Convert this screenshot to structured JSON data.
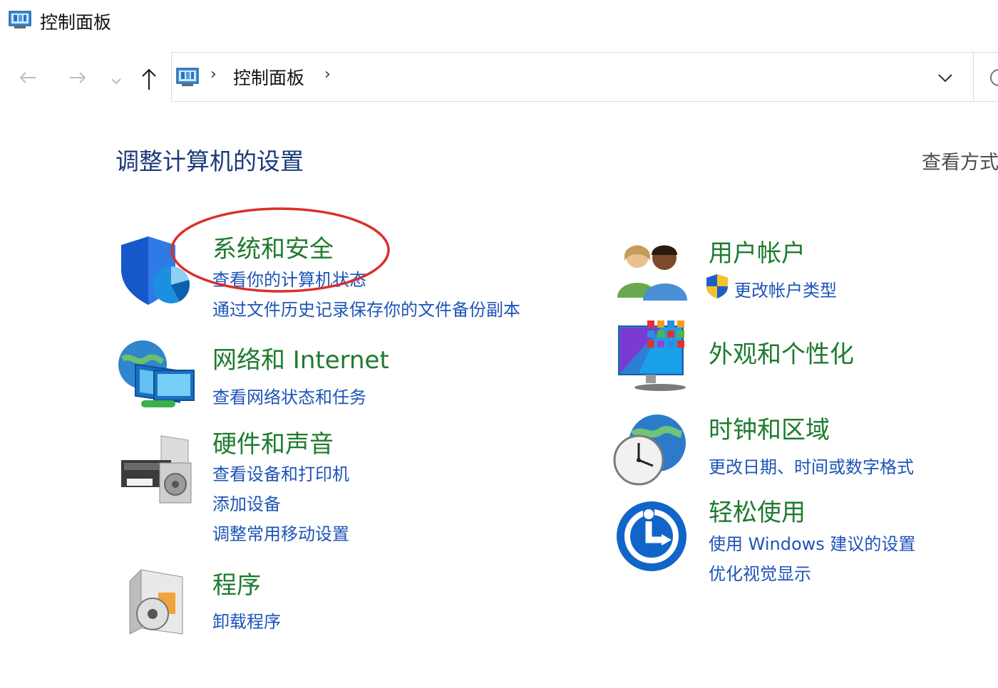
{
  "window": {
    "title": "控制面板"
  },
  "nav": {
    "back_icon": "arrow-left-icon",
    "forward_icon": "arrow-right-icon",
    "recent_icon": "chevron-down-icon",
    "up_icon": "arrow-up-icon"
  },
  "address": {
    "crumb": "控制面板",
    "sep": "›"
  },
  "main": {
    "heading": "调整计算机的设置",
    "view_by": "查看方式"
  },
  "categories": {
    "system": {
      "title": "系统和安全",
      "links": [
        "查看你的计算机状态",
        "通过文件历史记录保存你的文件备份副本"
      ],
      "icon": "shield-icon"
    },
    "network": {
      "title": "网络和 Internet",
      "links": [
        "查看网络状态和任务"
      ],
      "icon": "network-globe-icon"
    },
    "hardware": {
      "title": "硬件和声音",
      "links": [
        "查看设备和打印机",
        "添加设备",
        "调整常用移动设置"
      ],
      "icon": "printer-icon"
    },
    "programs": {
      "title": "程序",
      "links": [
        "卸载程序"
      ],
      "icon": "programs-disc-icon"
    },
    "users": {
      "title": "用户帐户",
      "links": [
        "更改帐户类型"
      ],
      "icon": "users-icon"
    },
    "appearance": {
      "title": "外观和个性化",
      "links": [],
      "icon": "monitor-palette-icon"
    },
    "clock": {
      "title": "时钟和区域",
      "links": [
        "更改日期、时间或数字格式"
      ],
      "icon": "clock-globe-icon"
    },
    "ease": {
      "title": "轻松使用",
      "links": [
        "使用 Windows 建议的设置",
        "优化视觉显示"
      ],
      "icon": "ease-of-access-icon"
    }
  },
  "colors": {
    "title_green": "#1e7b2e",
    "link_blue": "#1d54b8",
    "heading_blue": "#1b3a78",
    "annotation_red": "#d9302c"
  }
}
